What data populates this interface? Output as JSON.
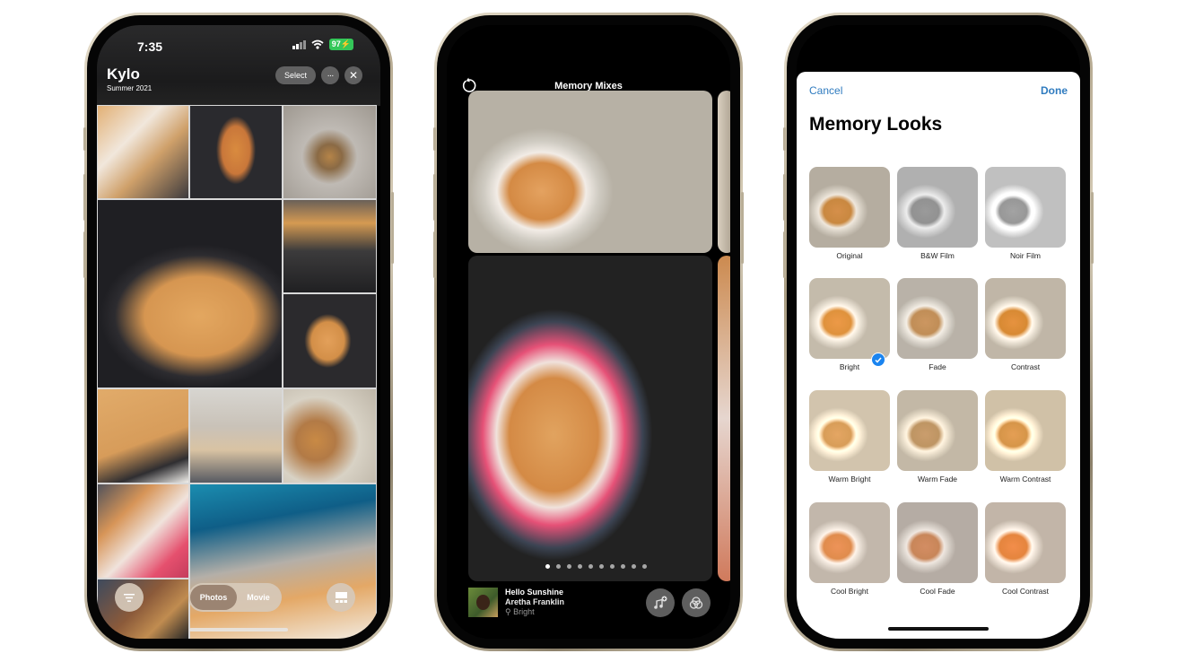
{
  "phone1": {
    "status": {
      "time": "7:35",
      "battery": "97"
    },
    "album": {
      "title": "Kylo",
      "subtitle": "Summer 2021"
    },
    "actions": {
      "select": "Select",
      "more": "···",
      "close": "✕"
    },
    "segmented": {
      "options": [
        "Photos",
        "Movie"
      ],
      "selected": "Photos"
    },
    "icons": {
      "filter": "filter-icon",
      "layout": "grid-layout-icon"
    }
  },
  "phone2": {
    "title": "Memory Mixes",
    "pager": {
      "total": 10,
      "current": 1
    },
    "song": {
      "title": "Hello Sunshine",
      "artist": "Aretha Franklin",
      "look": "Bright"
    },
    "icons": {
      "undo": "undo-icon",
      "add_music": "add-music-icon",
      "looks": "memory-looks-icon"
    }
  },
  "phone3": {
    "cancel": "Cancel",
    "done": "Done",
    "title": "Memory Looks",
    "selected": "Bright",
    "looks": [
      {
        "label": "Original"
      },
      {
        "label": "B&W Film"
      },
      {
        "label": "Noir Film"
      },
      {
        "label": "Bright"
      },
      {
        "label": "Fade"
      },
      {
        "label": "Contrast"
      },
      {
        "label": "Warm Bright"
      },
      {
        "label": "Warm Fade"
      },
      {
        "label": "Warm Contrast"
      },
      {
        "label": "Cool Bright"
      },
      {
        "label": "Cool Fade"
      },
      {
        "label": "Cool Contrast"
      }
    ]
  },
  "colors": {
    "accent_blue": "#2f7bbf",
    "check_blue": "#1a84f0",
    "battery_green": "#34c759",
    "segment_active": "#9b8472"
  }
}
